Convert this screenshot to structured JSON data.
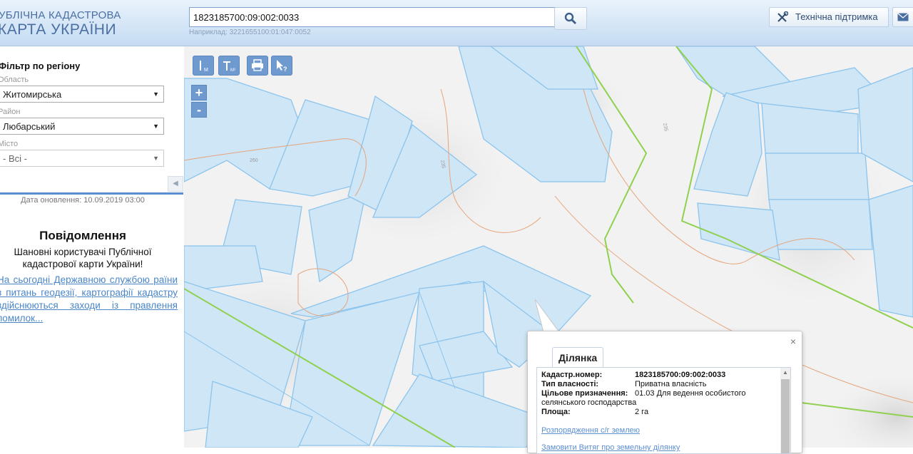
{
  "header": {
    "logo_line1": "УБЛІЧНА КАДАСТРОВА",
    "logo_line2": "КАРТА УКРАЇНИ",
    "search_value": "1823185700:09:002:0033",
    "search_hint": "Наприклад: 3221655100:01:047:0052",
    "search_icon": "search-icon",
    "support_label": "Технічна підтримка",
    "support_icon": "tools-icon",
    "mail_icon": "mail-icon"
  },
  "sidebar": {
    "filter_title": "Фільтр по регіону",
    "oblast_label": "Область",
    "oblast_value": "Житомирська",
    "rayon_label": "Район",
    "rayon_value": "Любарський",
    "city_label": "Місто",
    "city_value": "- Всі -",
    "updated": "Дата оновлення: 10.09.2019 03:00",
    "notice_title": "Повідомлення",
    "notice_text": "Шановні користувачі Публічної кадастрової карти України!",
    "notice_link": "На сьогодні Державною службою раїни з питань геодезії, картографії кадастру здійснюються заходи із правлення помилок..."
  },
  "map": {
    "tools": [
      {
        "name": "measure-length-tool",
        "label": "M"
      },
      {
        "name": "measure-area-tool",
        "label": "M²"
      },
      {
        "name": "print-tool",
        "label": ""
      },
      {
        "name": "identify-tool",
        "label": "?"
      }
    ],
    "zoom_in": "+",
    "zoom_out": "-",
    "contour_labels": [
      "260",
      "235",
      "235"
    ],
    "colors": {
      "parcel_fill": "#cfe6f7",
      "parcel_stroke": "#8cc4ec",
      "boundary": "#8fd14f",
      "contour": "#e6a47a"
    }
  },
  "popup": {
    "tab": "Ділянка",
    "close": "×",
    "rows": [
      {
        "key": "Кадастр.номер:",
        "value": "1823185700:09:002:0033"
      },
      {
        "key": "Тип власності:",
        "value": "Приватна власність"
      },
      {
        "key": "Цільове призначення:",
        "value": "01.03 Для ведення особистого"
      },
      {
        "key": "селянського господарства",
        "value": ""
      },
      {
        "key": "Площа:",
        "value": "2 га"
      }
    ],
    "link1": "Розпорядження с/г землею",
    "link2": "Замовити Витяг про земельну ділянку"
  }
}
